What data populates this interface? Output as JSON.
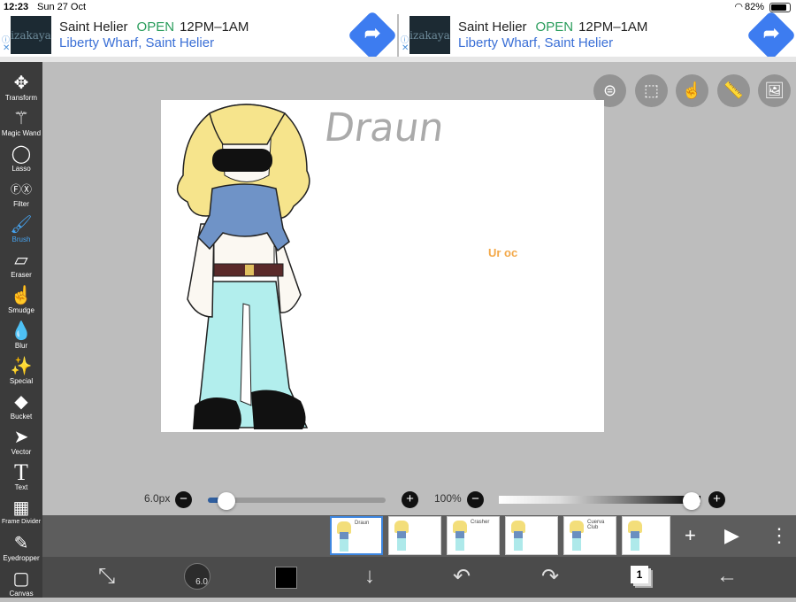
{
  "status_bar": {
    "time": "12:23",
    "date": "Sun 27 Oct",
    "battery": "82%"
  },
  "ads": [
    {
      "logo": "izakaya",
      "place": "Saint Helier",
      "status": "OPEN",
      "hours": "12PM–1AM",
      "address": "Liberty Wharf, Saint Helier"
    },
    {
      "logo": "izakaya",
      "place": "Saint Helier",
      "status": "OPEN",
      "hours": "12PM–1AM",
      "address": "Liberty Wharf, Saint Helier"
    }
  ],
  "tools": [
    {
      "label": "Transform",
      "icon": "move-icon"
    },
    {
      "label": "Magic Wand",
      "icon": "magic-wand-icon"
    },
    {
      "label": "Lasso",
      "icon": "lasso-icon"
    },
    {
      "label": "Filter",
      "icon": "fx-icon"
    },
    {
      "label": "Brush",
      "icon": "brush-icon"
    },
    {
      "label": "Eraser",
      "icon": "eraser-icon"
    },
    {
      "label": "Smudge",
      "icon": "smudge-icon"
    },
    {
      "label": "Blur",
      "icon": "blur-drop-icon"
    },
    {
      "label": "Special",
      "icon": "special-icon"
    },
    {
      "label": "Bucket",
      "icon": "bucket-icon"
    },
    {
      "label": "Vector",
      "icon": "cursor-icon"
    },
    {
      "label": "Text",
      "icon": "text-icon"
    },
    {
      "label": "Frame Divider",
      "icon": "frame-divider-icon"
    },
    {
      "label": "Eyedropper",
      "icon": "eyedropper-icon"
    },
    {
      "label": "Canvas",
      "icon": "canvas-icon"
    }
  ],
  "active_tool": "Brush",
  "canvas_text": {
    "title": "Draun",
    "note": "Ur oc"
  },
  "brush": {
    "size_label": "6.0px",
    "size_value": "6.0",
    "size_fraction": 0.11
  },
  "opacity": {
    "label": "100%",
    "fraction": 1.0
  },
  "frames": [
    {
      "caption": "Draun",
      "selected": true
    },
    {
      "caption": "",
      "selected": false
    },
    {
      "caption": "Crasher",
      "selected": false
    },
    {
      "caption": "",
      "selected": false
    },
    {
      "caption": "Cuerva Club",
      "selected": false
    },
    {
      "caption": "",
      "selected": false
    }
  ],
  "layer_count": "1",
  "colors": {
    "toolbar": "#3b3b3b",
    "accent": "#46a3f0",
    "primary_color": "#000000"
  }
}
